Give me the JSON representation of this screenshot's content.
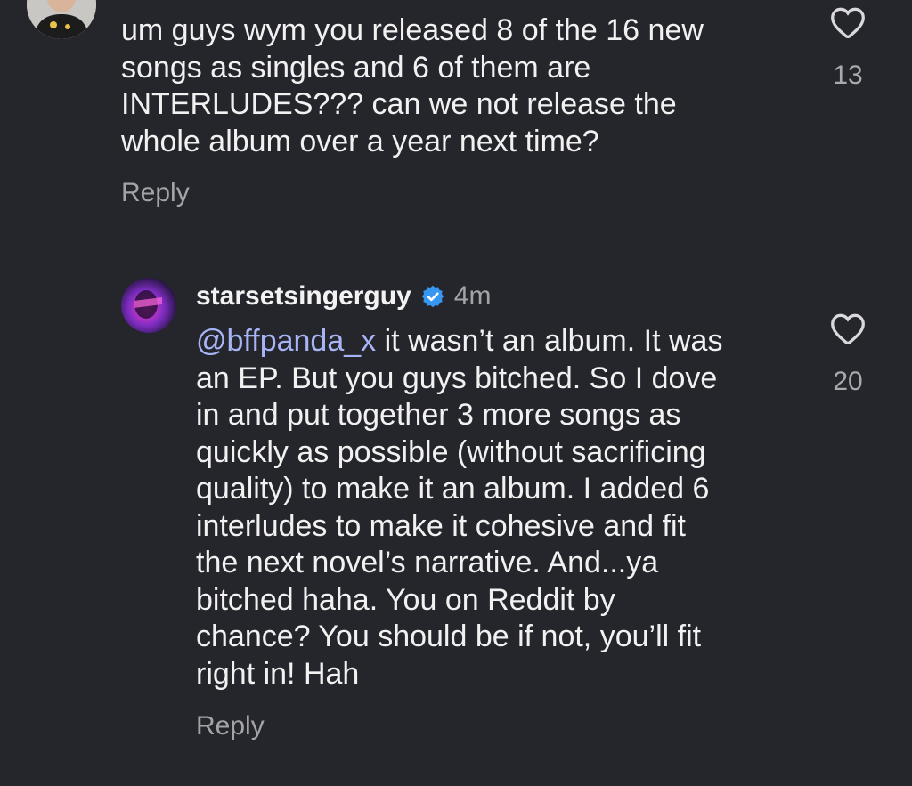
{
  "comments": {
    "top": {
      "text": "um guys wym you released 8 of the 16 new\nsongs as singles and 6 of them are\nINTERLUDES??? can we not release the\nwhole album over a year next time?",
      "like_count": "13",
      "reply_label": "Reply"
    },
    "reply": {
      "username": "starsetsingerguy",
      "timestamp": "4m",
      "mention": "@bffpanda_x",
      "text": " it wasn’t an album. It was\nan EP. But you guys bitched. So I dove\nin and put together 3 more songs as\nquickly as possible (without sacrificing\nquality) to make it an album. I added 6\ninterludes to make it cohesive and fit\nthe next novel’s narrative. And...ya\nbitched haha. You on Reddit by\nchance? You should be if not, you’ll fit\nright in! Hah",
      "like_count": "20",
      "reply_label": "Reply"
    }
  },
  "icons": {
    "like": "heart-outline-icon",
    "verified": "verified-badge-icon"
  },
  "colors": {
    "background": "#25262b",
    "mention": "#a7b5f7",
    "verified": "#3797f0",
    "muted": "#a3a3a8"
  }
}
